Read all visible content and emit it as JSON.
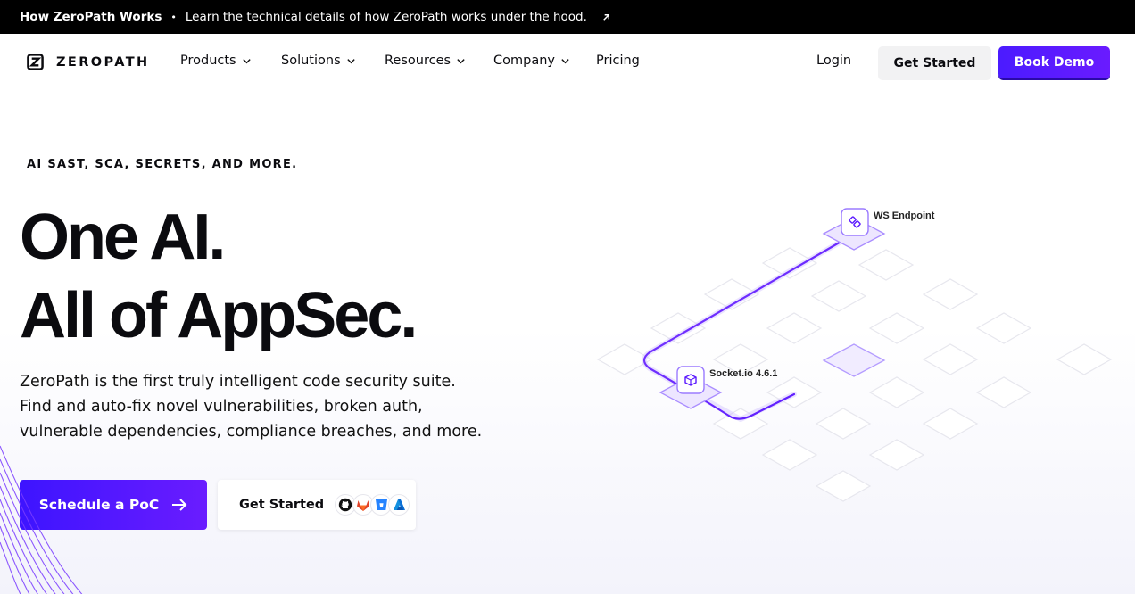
{
  "announcement": {
    "title": "How ZeroPath Works",
    "separator": "•",
    "text": "Learn the technical details of how ZeroPath works under the hood.",
    "arrow_icon": "arrow-up-right-icon"
  },
  "nav": {
    "logo_text": "ZEROPATH",
    "menu": [
      {
        "label": "Products",
        "has_dropdown": true
      },
      {
        "label": "Solutions",
        "has_dropdown": true
      },
      {
        "label": "Resources",
        "has_dropdown": true
      },
      {
        "label": "Company",
        "has_dropdown": true
      },
      {
        "label": "Pricing",
        "has_dropdown": false
      }
    ],
    "login": "Login",
    "get_started": "Get Started",
    "book_demo": "Book Demo"
  },
  "hero": {
    "eyebrow": "AI SAST, SCA, SECRETS, AND MORE.",
    "headline_line1": "One AI.",
    "headline_line2": "All of AppSec.",
    "lead": "ZeroPath is the first truly intelligent code security suite. Find and auto-fix novel vulnerabilities, broken auth, vulnerable dependencies, compliance breaches, and more.",
    "cta_primary": "Schedule a PoC",
    "cta_secondary": "Get Started",
    "providers": [
      "github-icon",
      "gitlab-icon",
      "bitbucket-icon",
      "azure-icon"
    ]
  },
  "illustration": {
    "node_top_label": "WS Endpoint",
    "node_bottom_label": "Socket.io 4.6.1"
  },
  "colors": {
    "accent": "#5b19ff",
    "accent_dark": "#3d14ff",
    "announce_bg": "#000000"
  }
}
